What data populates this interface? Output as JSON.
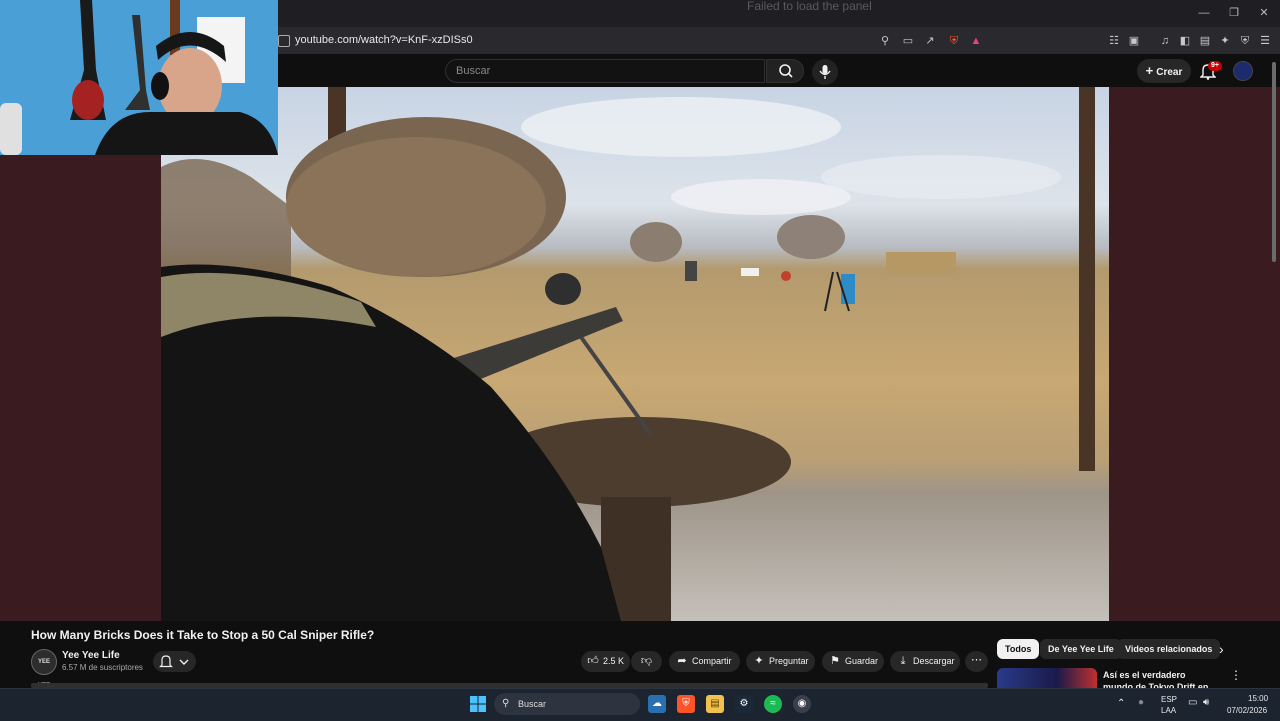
{
  "browser": {
    "title_text": "Failed to load the panel",
    "url": "youtube.com/watch?v=KnF-xzDISs0"
  },
  "youtube_header": {
    "search_placeholder": "Buscar",
    "create_label": "Crear",
    "notification_badge": "9+"
  },
  "video": {
    "title": "How Many Bricks Does it Take to Stop a 50 Cal Sniper Rifle?"
  },
  "channel": {
    "avatar_text": "YEE YEE",
    "name": "Yee Yee Life",
    "subscribers": "6.57 M de suscriptores"
  },
  "actions": {
    "likes": "2.5 K",
    "share": "Compartir",
    "ask": "Preguntar",
    "save": "Guardar",
    "download": "Descargar"
  },
  "related": {
    "chips": [
      "Todos",
      "De Yee Yee Life",
      "Videos relacionados"
    ],
    "first_title": "Así es el verdadero mundo de Tokyo Drift en Japón"
  },
  "taskbar": {
    "search_label": "Buscar",
    "lang_line1": "ESP",
    "lang_line2": "LAA",
    "time": "15:00",
    "date": "07/02/2026"
  },
  "colors": {
    "background": "#0f0f0f",
    "side_panels": "#3a1b20",
    "pill": "#272727",
    "webcam_wall": "#4aa0d6",
    "taskbar": "#1c2430"
  }
}
